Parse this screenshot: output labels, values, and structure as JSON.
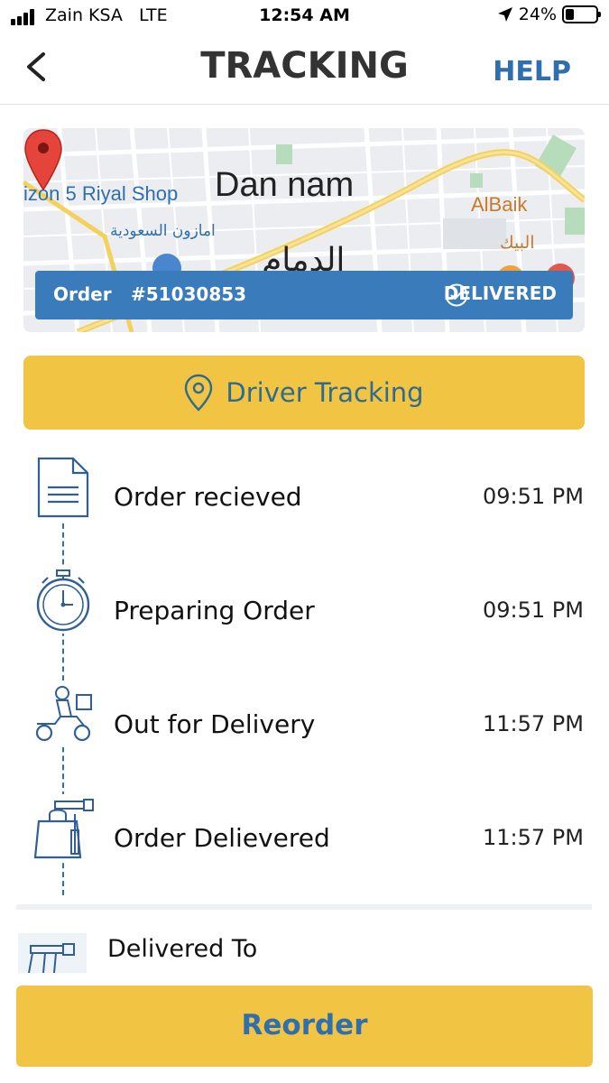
{
  "status_bar": {
    "carrier": "Zain KSA",
    "network": "LTE",
    "time": "12:54 AM",
    "battery": "24%",
    "battery_level": 0.24,
    "icons": [
      "signal-bars-icon",
      "location-arrow-icon",
      "battery-icon"
    ]
  },
  "header": {
    "title": "TRACKING",
    "help_label": "HELP",
    "back_icon": "chevron-left-icon"
  },
  "map": {
    "city_label": "Dan   nam",
    "shop_label": "izon 5 Riyal Shop",
    "shop_label_ar": "امازون السعودية",
    "poi_label": "AlBaik",
    "poi_label_ar": "البيك",
    "city_label_ar": "الدمام",
    "pin_icon": "map-pin-icon"
  },
  "order": {
    "label": "Order",
    "number": "#51030853",
    "status": "DELIVERED",
    "status_icon": "check-circle-icon"
  },
  "driver_tracking": {
    "label": "Driver Tracking",
    "icon": "location-pin-icon"
  },
  "steps": [
    {
      "label": "Order recieved",
      "time": "09:51 PM",
      "icon": "document-icon"
    },
    {
      "label": "Preparing Order",
      "time": "09:51 PM",
      "icon": "stopwatch-icon"
    },
    {
      "label": "Out for Delivery",
      "time": "11:57 PM",
      "icon": "delivery-scooter-icon"
    },
    {
      "label": "Order Delievered",
      "time": "11:57 PM",
      "icon": "package-handoff-icon"
    }
  ],
  "delivered_to": {
    "label": "Delivered To",
    "icon": "hand-delivery-icon"
  },
  "reorder": {
    "label": "Reorder"
  },
  "colors": {
    "accent_blue": "#2f6fae",
    "banner_blue": "#3a7bbb",
    "button_yellow": "#f2c443"
  }
}
